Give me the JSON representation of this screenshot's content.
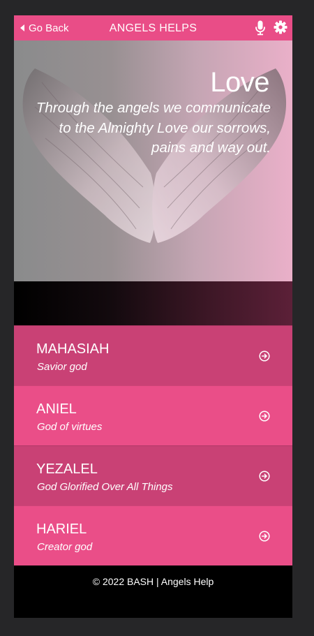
{
  "header": {
    "back_label": "Go Back",
    "title": "ANGELS HELPS",
    "icons": [
      "chevron-left-icon",
      "microphone-icon",
      "gear-icon"
    ]
  },
  "hero": {
    "title": "Love",
    "text": "Through the angels we communicate to the Almighty Love our sorrows, pains and way out."
  },
  "angels": [
    {
      "name": "MAHASIAH",
      "subtitle": "Savior god"
    },
    {
      "name": "ANIEL",
      "subtitle": "God of virtues"
    },
    {
      "name": "YEZALEL",
      "subtitle": "God Glorified Over All Things"
    },
    {
      "name": "HARIEL",
      "subtitle": "Creator god"
    }
  ],
  "footer": {
    "text": "© 2022 BASH | Angels Help"
  },
  "colors": {
    "header": "#e94d87",
    "item_dark": "#c94175",
    "item_light": "#ea4e88",
    "page_bg": "#262628"
  }
}
